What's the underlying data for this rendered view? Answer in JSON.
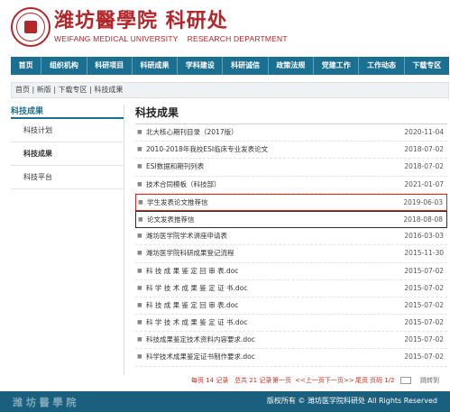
{
  "header": {
    "title_cn": "潍坊醫學院 科研处",
    "university_en": "WEIFANG MEDICAL UNIVERSITY",
    "department_en": "RESEARCH DEPARTMENT"
  },
  "nav": {
    "items": [
      "首页",
      "组织机构",
      "科研项目",
      "科研成果",
      "学科建设",
      "科研诚信",
      "政策法规",
      "党建工作",
      "工作动态",
      "下载专区"
    ]
  },
  "breadcrumb": "首页 | 新版 | 下载专区 | 科技成果",
  "sidebar": {
    "title": "科技成果",
    "items": [
      "科技计划",
      "科技成果",
      "科技平台"
    ]
  },
  "main": {
    "title": "科技成果",
    "rows": [
      {
        "title": "北大核心期刊目录（2017版）",
        "date": "2020-11-04"
      },
      {
        "title": "2010-2018年我校ESI临床专业发表论文",
        "date": "2018-07-02"
      },
      {
        "title": "ESI数据和期刊列表",
        "date": "2018-07-02"
      },
      {
        "title": "技术合同模板（科技部）",
        "date": "2021-01-07"
      },
      {
        "title": "学生发表论文推荐信",
        "date": "2019-06-03"
      },
      {
        "title": "论文发表推荐信",
        "date": "2018-08-08"
      },
      {
        "title": "潍坊医学院学术讲座申请表",
        "date": "2016-03-03"
      },
      {
        "title": "潍坊医学院科研成果登记流程",
        "date": "2015-11-30"
      },
      {
        "title": "科 技 成 果 鉴 定 回 审 表.doc",
        "date": "2015-07-02"
      },
      {
        "title": "科 学 技 术 成 果 鉴 定 证 书.doc",
        "date": "2015-07-02"
      },
      {
        "title": "科 技 成 果 鉴 定 回 审 表.doc",
        "date": "2015-07-02"
      },
      {
        "title": "科 学 技 术 成 果 鉴 定 证 书.doc",
        "date": "2015-07-02"
      },
      {
        "title": "科技成果鉴定技术资料内容要求.doc",
        "date": "2015-07-02"
      },
      {
        "title": "科学技术成果鉴定证书制作要求.doc",
        "date": "2015-07-02"
      }
    ]
  },
  "pager": {
    "total": "每页 14 记录",
    "records": "总共 21 记录",
    "first": "第一页",
    "prev": "<<上一页",
    "next": "下一页>>",
    "last": "尾页",
    "page": "页码 1/2",
    "jump": "跳转到"
  },
  "footer": {
    "logo_text": "潍 坊 醫 學 院",
    "copyright": "版权所有 © 潍坊医学院科研处 All Rights Reserved"
  },
  "colors": {
    "brand_red": "#b3262a",
    "nav_blue": "#1b6f90",
    "highlight_red": "#d9291c",
    "highlight_dark": "#2d2d2d",
    "footer_blue": "#1a5f7e"
  }
}
